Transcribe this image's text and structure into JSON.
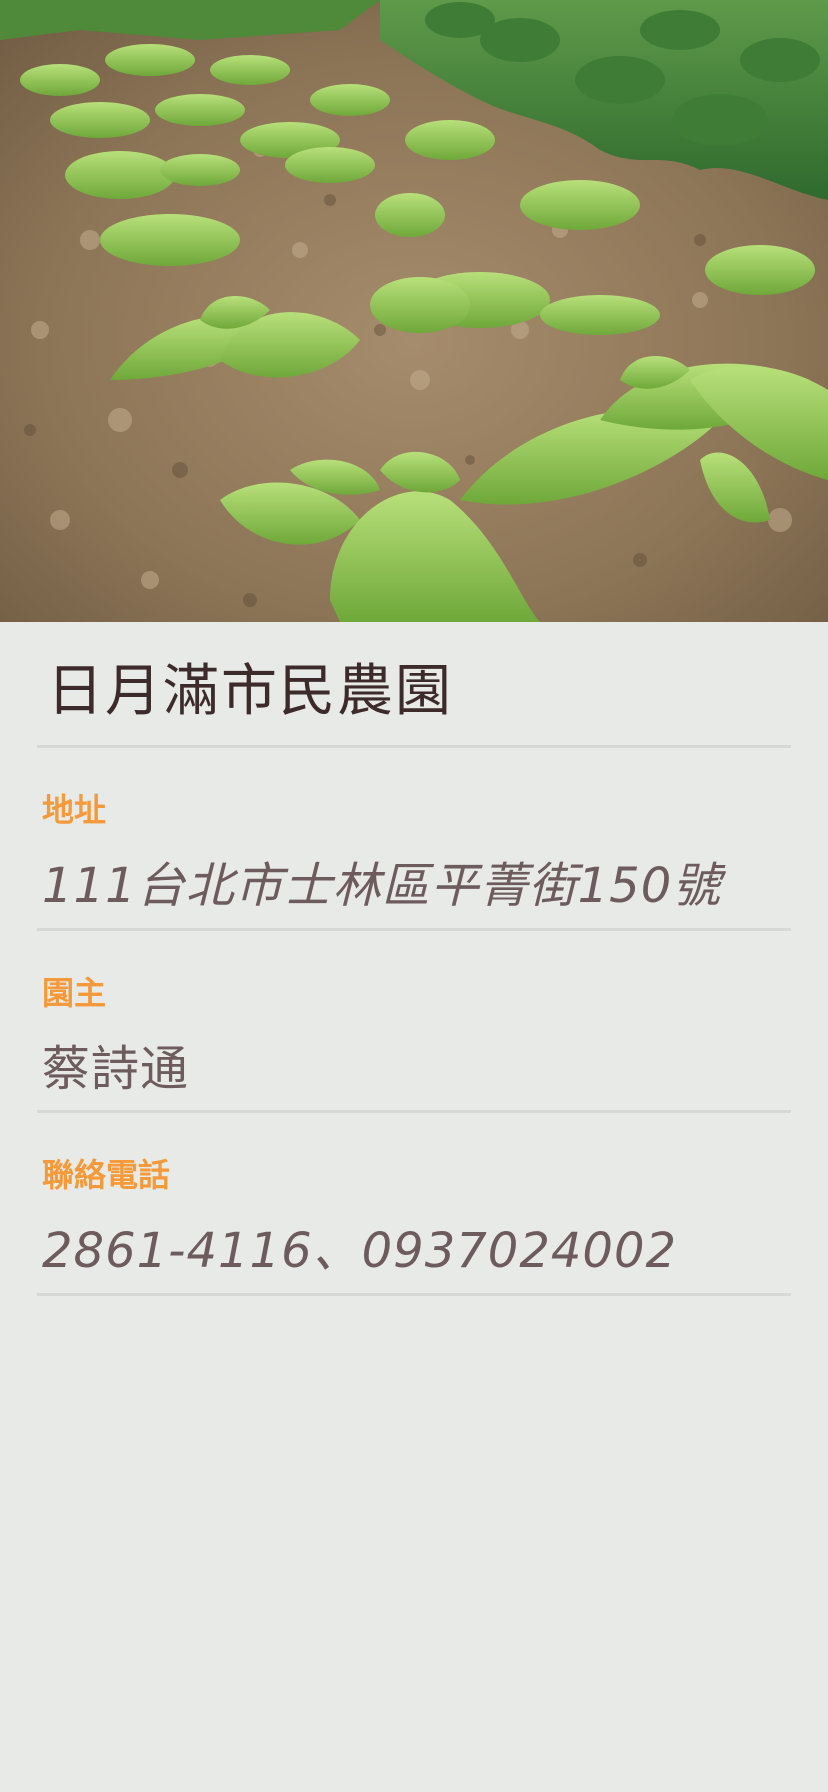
{
  "hero": {
    "image_icon": "vegetable-field-photo"
  },
  "farm": {
    "name": "日月滿市民農園"
  },
  "fields": {
    "address": {
      "label": "地址",
      "value": "111台北市士林區平菁街150號"
    },
    "owner": {
      "label": "園主",
      "value": "蔡詩通"
    },
    "phone": {
      "label": "聯絡電話",
      "value": "2861-4116、0937024002"
    }
  },
  "colors": {
    "background": "#e7eae6",
    "label_accent": "#f59a3b",
    "title_text": "#3d2b2b",
    "value_text": "#6d5b5d",
    "divider": "#d5d8d4"
  }
}
